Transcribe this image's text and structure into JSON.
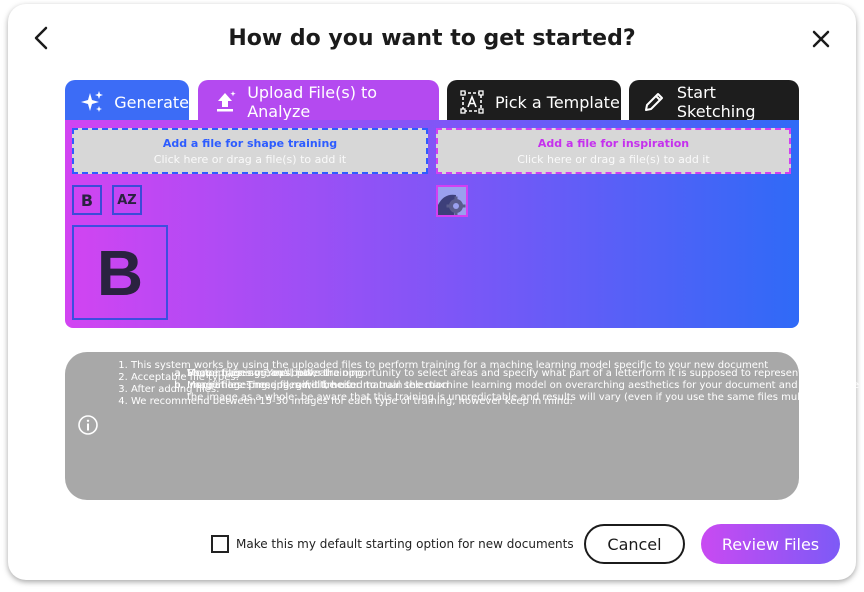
{
  "dialog": {
    "title": "How do you want to get started?"
  },
  "tabs": [
    {
      "label": "Generate",
      "icon": "sparkle-icon",
      "color": "#3c6cf6"
    },
    {
      "label": "Upload File(s) to Analyze",
      "icon": "upload-icon",
      "color": "#b44af0",
      "active": true
    },
    {
      "label": "Pick a Template",
      "icon": "template-icon",
      "color": "#1d1d1d"
    },
    {
      "label": "Start Sketching",
      "icon": "pencil-icon",
      "color": "#1d1d1d"
    }
  ],
  "upload": {
    "shape": {
      "title": "Add a file for shape training",
      "subtitle": "Click here or drag a file(s) to add it"
    },
    "inspiration": {
      "title": "Add a file for inspiration",
      "subtitle": "Click here or drag a file(s) to add it"
    },
    "mini_buttons": {
      "bold_label": "B",
      "az_label": "AZ"
    },
    "preview_letter": "B"
  },
  "info": {
    "items": [
      "This system works by using the uploaded files to perform training for a machine learning model specific to your new document",
      "Acceptable file types:",
      "Vector files: svg, eps, pdf, ai",
      "Image files: png, jpg, gif, tif, heic",
      "After adding files:",
      "Shape training: You'll have the opportunity to select areas and specify what part of a letterform it is supposed to represent",
      "Inspiration: These files will be used to train the machine learning model on overarching aesthetics for your document and will analyze the image as a whole; be aware that this training is unpredictable and results will vary (even if you use the same files multiple times)",
      "We recommend between 15-30 images for each type of training, however keep in mind:",
      "More images means better training",
      "More images means more time for manual selection"
    ]
  },
  "footer": {
    "default_label": "Make this my default starting option for new documents",
    "cancel_label": "Cancel",
    "review_label": "Review Files"
  },
  "colors": {
    "accent_blue": "#3c6cf6",
    "accent_purple": "#b44af0",
    "dark_tab": "#1d1d1d",
    "info_bg": "#a8a8a8"
  }
}
